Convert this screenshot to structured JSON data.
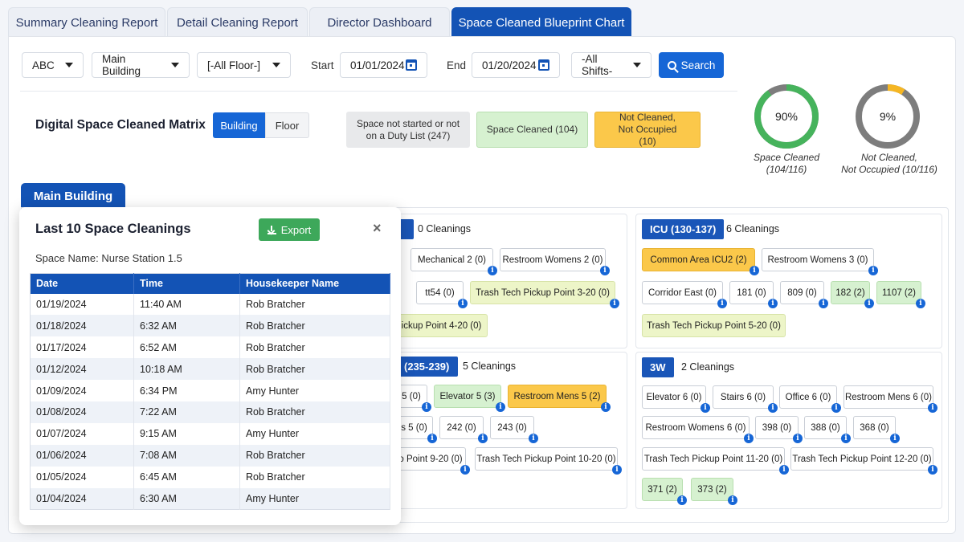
{
  "tabs": [
    "Summary Cleaning Report",
    "Detail Cleaning Report",
    "Director Dashboard",
    "Space Cleaned Blueprint Chart"
  ],
  "filters": {
    "org": "ABC",
    "building": "Main Building",
    "floor": "[-All Floor-]",
    "start_label": "Start",
    "start_date": "01/01/2024",
    "end_label": "End",
    "end_date": "01/20/2024",
    "shift": "-All Shifts-",
    "search_label": "Search"
  },
  "matrix": {
    "title": "Digital Space Cleaned Matrix",
    "toggle_building": "Building",
    "toggle_floor": "Floor",
    "legend_not_started": "Space not started or not on a Duty List (247)",
    "legend_cleaned": "Space Cleaned (104)",
    "legend_not_cleaned": "Not Cleaned, Not Occupied (10)"
  },
  "donuts": [
    {
      "pct_text": "90%",
      "fraction": 0.9,
      "label_line1": "Space Cleaned",
      "label_line2": "(104/116)",
      "color": "#46b35c"
    },
    {
      "pct_text": "9%",
      "fraction": 0.09,
      "label_line1": "Not Cleaned,",
      "label_line2": "Not Occupied (10/116)",
      "color": "#f5b623"
    }
  ],
  "building_tab": "Main Building",
  "zones": {
    "z1": {
      "title": "",
      "count": "0 Cleanings"
    },
    "icu": {
      "title": "ICU (130-137)",
      "count": "6 Cleanings"
    },
    "z3": {
      "title": "(235-239)",
      "count": "5 Cleanings"
    },
    "w3": {
      "title": "3W",
      "count": "2 Cleanings"
    }
  },
  "chips": {
    "z1": [
      "Mechanical 2 (0)",
      "Restroom Womens 2 (0)",
      "tt54 (0)",
      "Trash Tech Pickup Point 3-20 (0)",
      "ickup Point 4-20 (0)"
    ],
    "icu": [
      "Common Area ICU2 (2)",
      "Restroom Womens 3 (0)",
      "Corridor East (0)",
      "181 (0)",
      "809 (0)",
      "182 (2)",
      "1107 (2)",
      "Trash Tech Pickup Point 5-20 (0)"
    ],
    "z3": [
      "5 (0)",
      "Elevator 5 (3)",
      "Restroom Mens 5 (2)",
      "s 5 (0)",
      "242 (0)",
      "243 (0)",
      "o Point 9-20 (0)",
      "Trash Tech Pickup Point 10-20 (0)"
    ],
    "w3": [
      "Elevator 6 (0)",
      "Stairs 6 (0)",
      "Office 6 (0)",
      "Restroom Mens 6 (0)",
      "Restroom Womens 6 (0)",
      "398 (0)",
      "388 (0)",
      "368 (0)",
      "Trash Tech Pickup Point 11-20 (0)",
      "Trash Tech Pickup Point 12-20 (0)",
      "371 (2)",
      "373 (2)"
    ]
  },
  "modal": {
    "title": "Last 10 Space Cleanings",
    "export_label": "Export",
    "close": "×",
    "space_name": "Space Name: Nurse Station 1.5",
    "columns": [
      "Date",
      "Time",
      "Housekeeper Name"
    ],
    "rows": [
      [
        "01/19/2024",
        "11:40 AM",
        "Rob Bratcher"
      ],
      [
        "01/18/2024",
        "6:32 AM",
        "Rob Bratcher"
      ],
      [
        "01/17/2024",
        "6:52 AM",
        "Rob Bratcher"
      ],
      [
        "01/12/2024",
        "10:18 AM",
        "Rob Bratcher"
      ],
      [
        "01/09/2024",
        "6:34 PM",
        "Amy Hunter"
      ],
      [
        "01/08/2024",
        "7:22 AM",
        "Rob Bratcher"
      ],
      [
        "01/07/2024",
        "9:15 AM",
        "Amy Hunter"
      ],
      [
        "01/06/2024",
        "7:08 AM",
        "Rob Bratcher"
      ],
      [
        "01/05/2024",
        "6:45 AM",
        "Rob Bratcher"
      ],
      [
        "01/04/2024",
        "6:30 AM",
        "Amy Hunter"
      ]
    ]
  }
}
